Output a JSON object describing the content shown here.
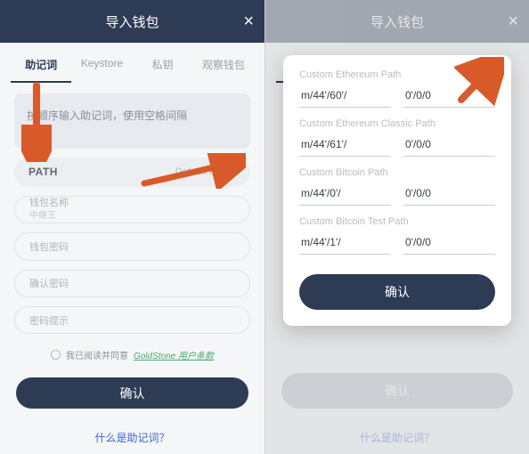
{
  "header": {
    "title": "导入钱包",
    "close": "×"
  },
  "tabs": [
    {
      "label": "助记词",
      "active": true
    },
    {
      "label": "Keystore"
    },
    {
      "label": "私钥"
    },
    {
      "label": "观察钱包"
    }
  ],
  "left": {
    "mnemonic_placeholder": "按顺序输入助记词，使用空格间隔",
    "path": {
      "label": "PATH",
      "value": "Default Path"
    },
    "chevron": "›",
    "fields": {
      "name_label": "钱包名称",
      "name_hint": "中继王",
      "pwd_label": "钱包密码",
      "pwd2_label": "确认密码",
      "hint_label": "密码提示"
    },
    "terms": {
      "prefix": "我已阅读并同意",
      "link": "GoldStone 用户条款"
    },
    "confirm": "确认",
    "footer_link": "什么是助记词？"
  },
  "modal": {
    "groups": [
      {
        "title": "Custom Ethereum Path",
        "prefix": "m/44'/60'/",
        "suffix": "0'/0/0"
      },
      {
        "title": "Custom Ethereum Classic Path",
        "prefix": "m/44'/61'/",
        "suffix": "0'/0/0"
      },
      {
        "title": "Custom Bitcoin Path",
        "prefix": "m/44'/0'/",
        "suffix": "0'/0/0"
      },
      {
        "title": "Custom Bitcoin Test Path",
        "prefix": "m/44'/1'/",
        "suffix": "0'/0/0"
      }
    ],
    "confirm": "确认"
  }
}
